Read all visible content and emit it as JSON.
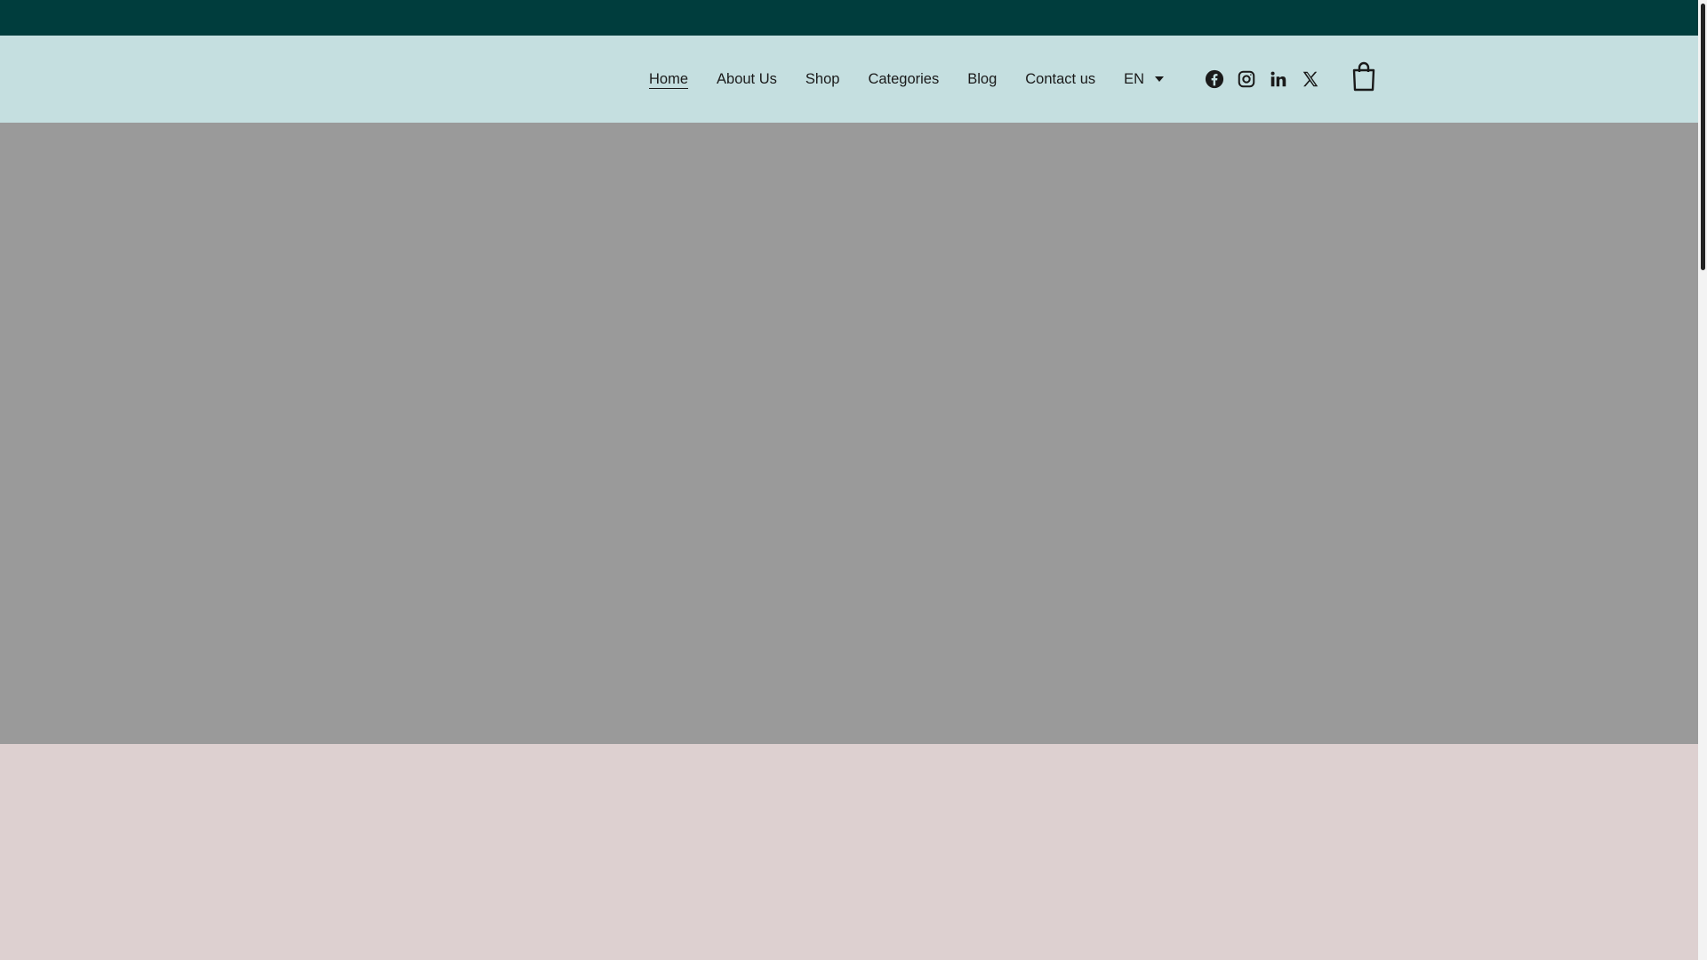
{
  "nav": {
    "items": [
      {
        "label": "Home",
        "active": true
      },
      {
        "label": "About Us",
        "active": false
      },
      {
        "label": "Shop",
        "active": false
      },
      {
        "label": "Categories",
        "active": false
      },
      {
        "label": "Blog",
        "active": false
      },
      {
        "label": "Contact us",
        "active": false
      }
    ],
    "language": "EN"
  },
  "social": [
    "facebook-icon",
    "instagram-icon",
    "linkedin-icon",
    "x-icon"
  ],
  "cart_icon": "shopping-bag-icon",
  "colors": {
    "topbar": "#003d3d",
    "header": "#c5dfe0",
    "hero": "#9a9a9a",
    "section": "#ddd0d0"
  }
}
